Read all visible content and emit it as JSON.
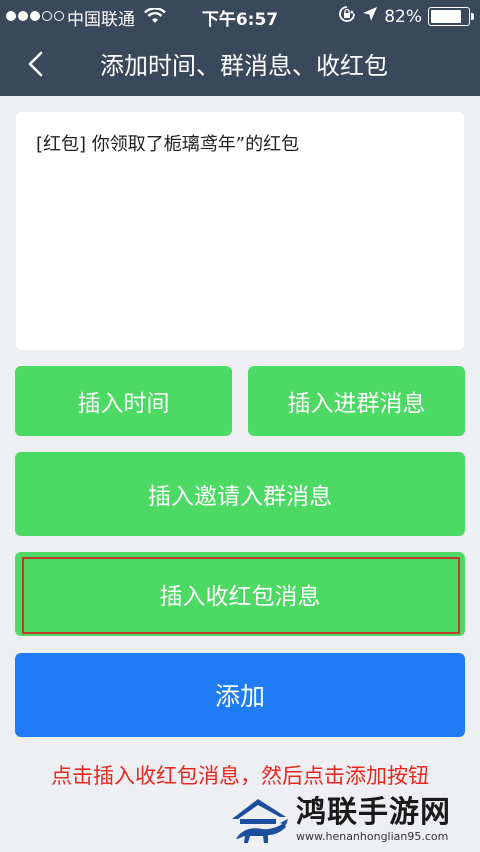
{
  "status_bar": {
    "carrier": "中国联通",
    "time": "下午6:57",
    "battery_text": "82%",
    "battery_level": 0.82
  },
  "nav": {
    "title": "添加时间、群消息、收红包"
  },
  "message": {
    "text": "[红包] 你领取了栀璃鸢年”的红包"
  },
  "buttons": {
    "insert_time": "插入时间",
    "insert_join_group": "插入进群消息",
    "insert_invite_group": "插入邀请入群消息",
    "insert_red_packet": "插入收红包消息",
    "add": "添加"
  },
  "instruction": "点击插入收红包消息，然后点击添加按钮",
  "watermark": {
    "name": "鸿联手游网",
    "url": "www.henanhonglian95.com"
  },
  "colors": {
    "header_bg": "#39485a",
    "green_button": "#4cd964",
    "blue_button": "#1f7cf5",
    "highlight_red": "#c0392b",
    "instruction_red": "#e8281e"
  },
  "icons": {
    "back": "chevron-left-icon",
    "wifi": "wifi-icon",
    "lock_rotation": "rotation-lock-icon",
    "location": "location-arrow-icon",
    "battery": "battery-icon"
  }
}
